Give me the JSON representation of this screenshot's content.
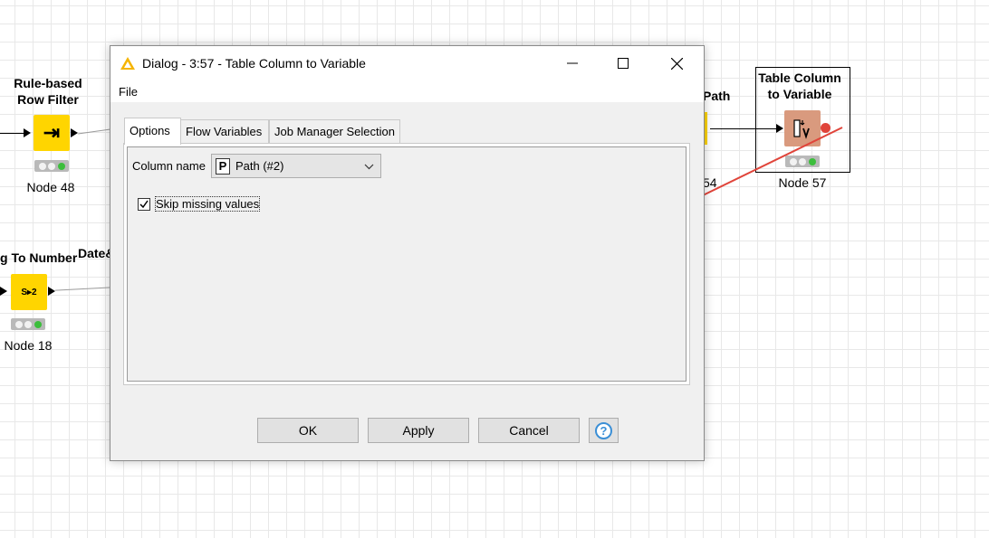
{
  "canvas": {
    "nodes": {
      "rule_row_filter": {
        "title_line1": "Rule-based",
        "title_line2": "Row Filter",
        "label": "Node 48",
        "icon_glyph": "⇥"
      },
      "string_to_number": {
        "title": "g To Number",
        "label": "Node 18",
        "icon_glyph": "S▸2"
      },
      "date_partial": {
        "title": "Date&"
      },
      "path_partial": {
        "title": "Path",
        "label_partial": "54"
      },
      "table_col_to_var": {
        "title_line1": "Table Column",
        "title_line2": "to Variable",
        "label": "Node 57"
      }
    },
    "colors": {
      "node_yellow": "#ffd500",
      "node_brown": "#d99a7e",
      "error_red": "#e0443a",
      "status_green": "#3cbe3c"
    }
  },
  "dialog": {
    "title": "Dialog - 3:57 - Table Column to Variable",
    "icon": "warning-triangle-icon",
    "menu": {
      "file": "File"
    },
    "tabs": [
      "Options",
      "Flow Variables",
      "Job Manager Selection"
    ],
    "options": {
      "column_name_label": "Column name",
      "column_type_badge": "P",
      "column_value": "Path (#2)",
      "skip_missing_label": "Skip missing values",
      "skip_missing_checked": true
    },
    "buttons": {
      "ok": "OK",
      "apply": "Apply",
      "cancel": "Cancel",
      "help": "?"
    }
  }
}
